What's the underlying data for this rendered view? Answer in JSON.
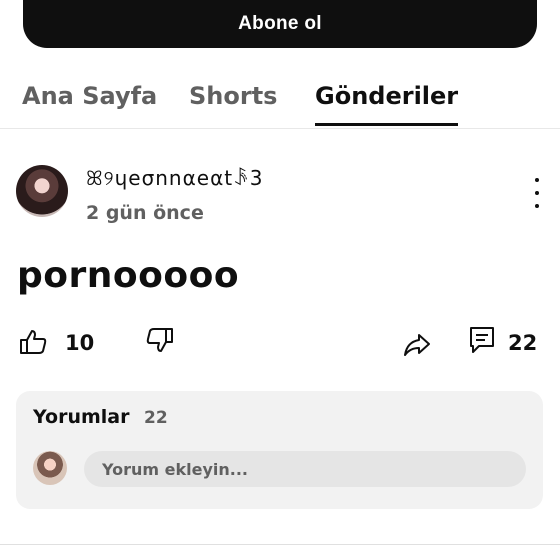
{
  "subscribe": {
    "label": "Abone ol"
  },
  "tabs": [
    {
      "label": "Ana Sayfa",
      "active": false
    },
    {
      "label": "Shorts",
      "active": false
    },
    {
      "label": "Gönderiler",
      "active": true
    }
  ],
  "post": {
    "author": "ꕤ୨ɥeσnnαeαtꂘ3",
    "time": "2 gün önce",
    "text": "pornooooo",
    "likes": "10",
    "comments": "22"
  },
  "icons": {
    "like": "thumbs-up-icon",
    "dislike": "thumbs-down-icon",
    "share": "share-icon",
    "comment": "comment-icon",
    "more": "more-vertical-icon"
  },
  "comments_section": {
    "title": "Yorumlar",
    "count": "22",
    "input_placeholder": "Yorum ekleyin..."
  },
  "colors": {
    "primary_text": "#0f0f0f",
    "secondary_text": "#606060",
    "card_background": "#f2f2f2",
    "button_background": "#0f0f0f"
  }
}
